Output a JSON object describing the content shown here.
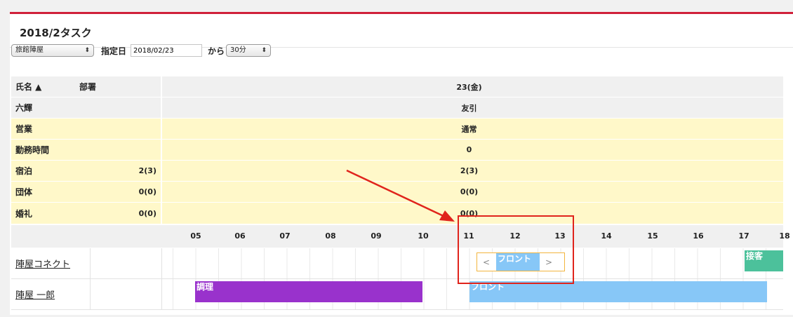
{
  "title": "2018/2タスク",
  "controls": {
    "ryokan_select": "旅館陣屋",
    "date_label": "指定日",
    "date_value": "2018/02/23",
    "from_label": "から",
    "interval_select": "30分"
  },
  "header": {
    "name_col": "氏名 ▲",
    "dept_col": "部署",
    "date": "23(金)"
  },
  "summary_rows": [
    {
      "label": "六輝",
      "left_value": "",
      "value": "友引",
      "style": "gray"
    },
    {
      "label": "営業",
      "left_value": "",
      "value": "通常",
      "style": "yellow"
    },
    {
      "label": "勤務時間",
      "left_value": "",
      "value": "0",
      "style": "yellow"
    },
    {
      "label": "宿泊",
      "left_value": "2(3)",
      "value": "2(3)",
      "style": "yellow"
    },
    {
      "label": "団体",
      "left_value": "0(0)",
      "value": "0(0)",
      "style": "yellow"
    },
    {
      "label": "婚礼",
      "left_value": "0(0)",
      "value": "0(0)",
      "style": "yellow"
    }
  ],
  "hours": [
    "05",
    "06",
    "07",
    "08",
    "09",
    "10",
    "11",
    "12",
    "13",
    "14",
    "15",
    "16",
    "17",
    "18"
  ],
  "staff": [
    {
      "name": "陣屋コネクト",
      "tasks": [
        {
          "label": "フロント",
          "color": "#87c7f7"
        },
        {
          "label": "接客",
          "color": "#4cc19b"
        }
      ]
    },
    {
      "name": "陣屋 一郎",
      "tasks": [
        {
          "label": "調理",
          "color": "#9932cc"
        },
        {
          "label": "フロント",
          "color": "#87c7f7"
        }
      ]
    }
  ],
  "nav_prev": "<",
  "nav_next": ">",
  "accent_color": "#d0203a",
  "annotation_color": "#e0241c"
}
